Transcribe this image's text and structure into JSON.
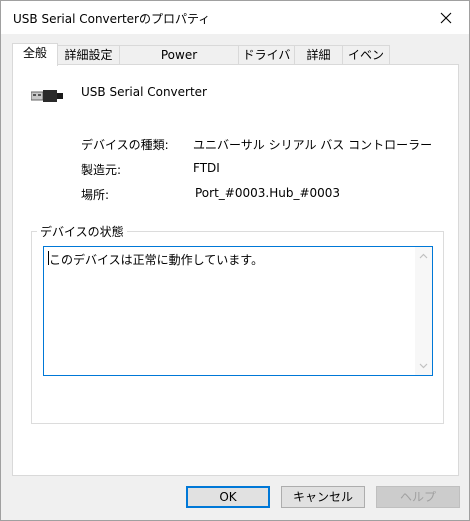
{
  "window": {
    "title": "USB Serial Converterのプロパティ"
  },
  "tabs": [
    {
      "label": "全般"
    },
    {
      "label": "詳細設定"
    },
    {
      "label": "Power Management"
    },
    {
      "label": "ドライバー"
    },
    {
      "label": "詳細"
    },
    {
      "label": "イベント"
    }
  ],
  "device": {
    "name": "USB Serial Converter",
    "icon": "usb-connector-icon"
  },
  "properties": [
    {
      "label": "デバイスの種類:",
      "value": "ユニバーサル シリアル バス コントローラー"
    },
    {
      "label": "製造元:",
      "value": "FTDI"
    },
    {
      "label": "場所:",
      "value": "Port_#0003.Hub_#0003"
    }
  ],
  "status": {
    "legend": "デバイスの状態",
    "text": "このデバイスは正常に動作しています。"
  },
  "buttons": {
    "ok": "OK",
    "cancel": "キャンセル",
    "help": "ヘルプ"
  },
  "colors": {
    "accent": "#0078d7",
    "background": "#f0f0f0"
  }
}
